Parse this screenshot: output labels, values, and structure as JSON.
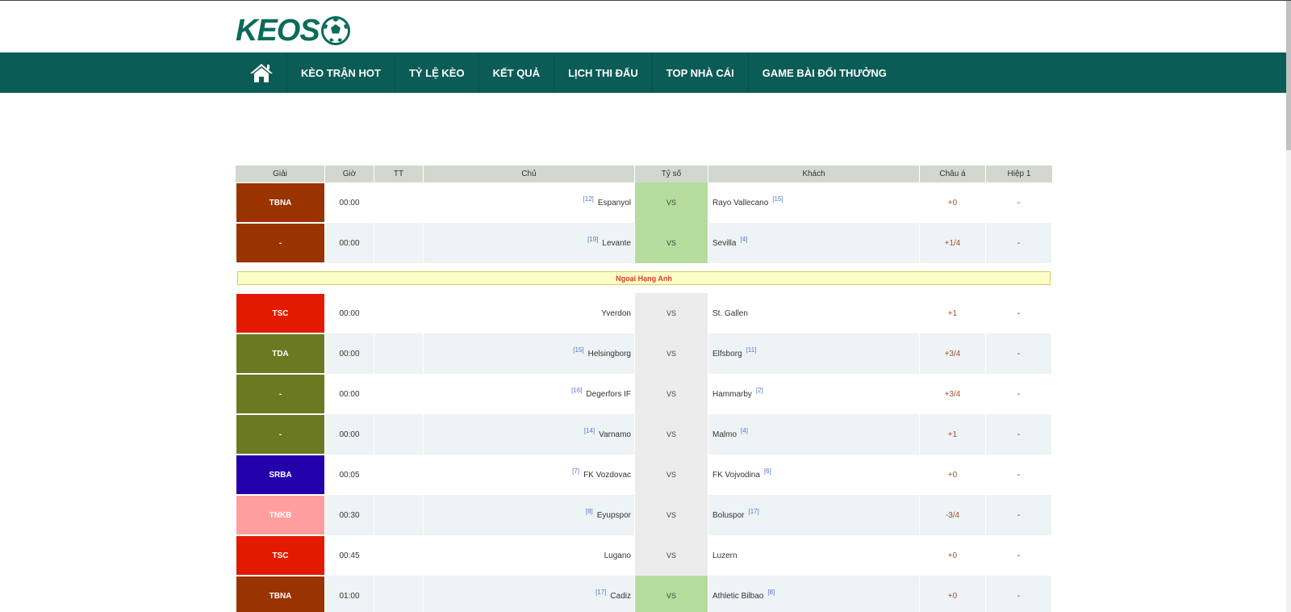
{
  "brand": {
    "logo_text": "KEOS"
  },
  "nav": {
    "items": [
      {
        "label": "KÈO TRẬN HOT"
      },
      {
        "label": "TỶ LỆ KÈO"
      },
      {
        "label": "KẾT QUẢ"
      },
      {
        "label": "LỊCH THI ĐẤU"
      },
      {
        "label": "TOP NHÀ CÁI"
      },
      {
        "label": "GAME BÀI ĐỔI THƯỞNG"
      }
    ]
  },
  "table": {
    "headers": {
      "league": "Giải",
      "time": "Giờ",
      "status": "TT",
      "home": "Chủ",
      "score": "Tỷ số",
      "away": "Khách",
      "handicap": "Châu á",
      "half1": "Hiệp 1"
    },
    "group1": [
      {
        "league": "TBNA",
        "league_color": "#993300",
        "time": "00:00",
        "status": "",
        "home_rank": "[12]",
        "home": "Espanyol",
        "score": "VS",
        "away": "Rayo Vallecano",
        "away_rank": "[15]",
        "handicap": "+0",
        "half1": "-"
      },
      {
        "league": "-",
        "league_color": "#993300",
        "time": "00:00",
        "status": "",
        "home_rank": "[19]",
        "home": "Levante",
        "score": "VS",
        "away": "Sevilla",
        "away_rank": "[4]",
        "handicap": "+1/4",
        "half1": "-"
      }
    ],
    "section_title": "Ngoại Hạng Anh",
    "group2": [
      {
        "league": "TSC",
        "league_color": "#e31a00",
        "time": "00:00",
        "status": "",
        "home_rank": "",
        "home": "Yverdon",
        "score": "VS",
        "away": "St. Gallen",
        "away_rank": "",
        "handicap": "+1",
        "half1": "-"
      },
      {
        "league": "TDA",
        "league_color": "#6b7a22",
        "time": "00:00",
        "status": "",
        "home_rank": "[15]",
        "home": "Helsingborg",
        "score": "VS",
        "away": "Elfsborg",
        "away_rank": "[11]",
        "handicap": "+3/4",
        "half1": "-"
      },
      {
        "league": "-",
        "league_color": "#6b7a22",
        "time": "00:00",
        "status": "",
        "home_rank": "[16]",
        "home": "Degerfors IF",
        "score": "VS",
        "away": "Hammarby",
        "away_rank": "[2]",
        "handicap": "+3/4",
        "half1": "-"
      },
      {
        "league": "-",
        "league_color": "#6b7a22",
        "time": "00:00",
        "status": "",
        "home_rank": "[14]",
        "home": "Varnamo",
        "score": "VS",
        "away": "Malmo",
        "away_rank": "[4]",
        "handicap": "+1",
        "half1": "-"
      },
      {
        "league": "SRBA",
        "league_color": "#2200aa",
        "time": "00:05",
        "status": "",
        "home_rank": "[7]",
        "home": "FK Vozdovac",
        "score": "VS",
        "away": "FK Vojvodina",
        "away_rank": "[6]",
        "handicap": "+0",
        "half1": "-"
      },
      {
        "league": "TNKB",
        "league_color": "#ff9e9e",
        "time": "00:30",
        "status": "",
        "home_rank": "[8]",
        "home": "Eyupspor",
        "score": "VS",
        "away": "Boluspor",
        "away_rank": "[17]",
        "handicap": "-3/4",
        "half1": "-"
      },
      {
        "league": "TSC",
        "league_color": "#e31a00",
        "time": "00:45",
        "status": "",
        "home_rank": "",
        "home": "Lugano",
        "score": "VS",
        "away": "Luzern",
        "away_rank": "",
        "handicap": "+0",
        "half1": "-"
      },
      {
        "league": "TBNA",
        "league_color": "#993300",
        "time": "01:00",
        "status": "",
        "home_rank": "[17]",
        "home": "Cadiz",
        "score": "VS",
        "away": "Athletic Bilbao",
        "away_rank": "[8]",
        "handicap": "+0",
        "half1": "-"
      }
    ]
  },
  "colors": {
    "nav_bg": "#0b5c56",
    "header_bg": "#d2d8cf",
    "score_green": "#b5dc9c",
    "handicap_text": "#a0522d"
  }
}
